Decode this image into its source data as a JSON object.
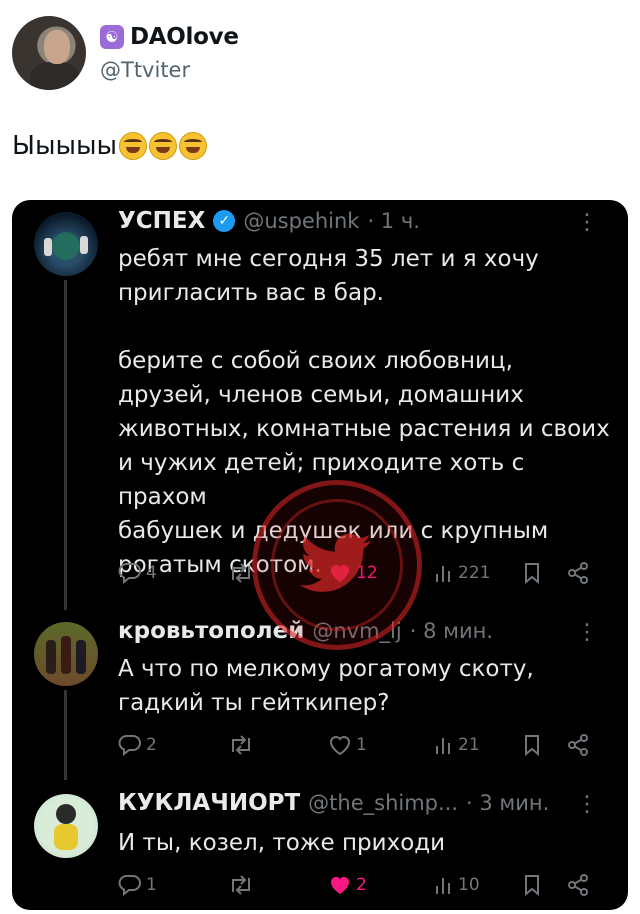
{
  "author": {
    "display_name": "DAOlove",
    "badge_icon": "yin-yang-icon",
    "handle": "@Ttviter"
  },
  "tweet": {
    "text": "Ыыыыы"
  },
  "posts": [
    {
      "name": "УСПЕХ",
      "handle": "@uspehink",
      "time": "· 1 ч.",
      "verified": true,
      "lines": [
        "ребят мне сегодня 35 лет и я хочу",
        "пригласить вас в бар.",
        "",
        "берите с собой своих любовниц,",
        "друзей, членов семьи, домашних",
        "животных, комнатные растения и своих",
        "и чужих детей; приходите хоть с прахом",
        "бабушек и дедушек или с крупным",
        "рогатым скотом."
      ],
      "replies": "4",
      "reposts": "",
      "likes": "12",
      "views": "221",
      "liked": true
    },
    {
      "name": "кровьтополей",
      "handle": "@nvm_lj",
      "time": "· 8 мин.",
      "lines": [
        "А что по мелкому рогатому скоту,",
        "гадкий ты гейткипер?"
      ],
      "replies": "2",
      "reposts": "",
      "likes": "1",
      "views": "21",
      "liked": false
    },
    {
      "name": "КУКЛАЧИОРТ",
      "handle": "@the_shimp...",
      "time": "· 3 мин.",
      "lines": [
        "И ты, козел, тоже приходи"
      ],
      "replies": "1",
      "reposts": "",
      "likes": "2",
      "views": "10",
      "liked": true
    }
  ],
  "more_label": "⋮",
  "colors": {
    "card_bg": "#000000",
    "like_pink": "#f91880",
    "verified_blue": "#1d9bf0",
    "muted": "#71767b",
    "watermark_red": "#dc2828"
  }
}
